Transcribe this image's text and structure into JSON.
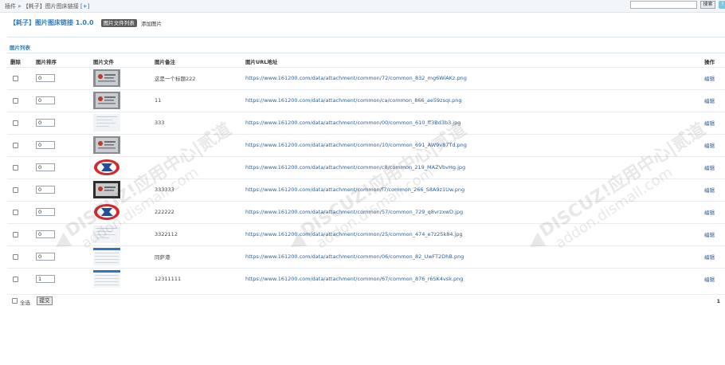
{
  "topbar": {
    "breadcrumb": "插件 » 【耗子】图片图床链接",
    "add_link": "[+]",
    "search_button": "搜索",
    "search_placeholder": ""
  },
  "header": {
    "plugin_title": "【耗子】图片图床链接 1.0.0",
    "tab_active": "图片文件列表",
    "tab_add": "添加图片"
  },
  "panel": {
    "title": "图片列表",
    "columns": [
      "删除",
      "图片排序",
      "图片文件",
      "图片备注",
      "图片URL地址",
      "操作"
    ]
  },
  "rows": [
    {
      "order": "0",
      "thumb": "certificate",
      "note": "这是一个标题222",
      "url": "https://www.161200.com/data/attachment/common/72/common_832_mg6WiAKz.png",
      "action": "编辑"
    },
    {
      "order": "0",
      "thumb": "certificate",
      "note": "11",
      "url": "https://www.161200.com/data/attachment/common/ca/common_866_ae59zsqI.png",
      "action": "编辑"
    },
    {
      "order": "0",
      "thumb": "document",
      "note": "333",
      "url": "https://www.161200.com/data/attachment/common/00/common_610_ff3Bd3b3.jpg",
      "action": "编辑"
    },
    {
      "order": "0",
      "thumb": "certificate",
      "note": "",
      "url": "https://www.161200.com/data/attachment/common/10/common_691_AW9v87Td.png",
      "action": "编辑"
    },
    {
      "order": "0",
      "thumb": "logo",
      "note": "",
      "url": "https://www.161200.com/data/attachment/common/c8/common_219_MAZVbvHg.jpg",
      "action": "编辑"
    },
    {
      "order": "0",
      "thumb": "certificate-dark",
      "note": "333333",
      "url": "https://www.161200.com/data/attachment/common/f7/common_266_S8A9z1Uw.png",
      "action": "编辑"
    },
    {
      "order": "0",
      "thumb": "logo",
      "note": "222222",
      "url": "https://www.161200.com/data/attachment/common/57/common_729_q8vrzxwD.jpg",
      "action": "编辑"
    },
    {
      "order": "0",
      "thumb": "document",
      "note": "3322112",
      "url": "https://www.161200.com/data/attachment/common/25/common_474_e7z25k84.jpg",
      "action": "编辑"
    },
    {
      "order": "0",
      "thumb": "screenshot",
      "note": "同萨港",
      "url": "https://www.161200.com/data/attachment/common/06/common_82_UwFT2DhB.png",
      "action": "编辑"
    },
    {
      "order": "1",
      "thumb": "screenshot",
      "note": "12311111",
      "url": "https://www.161200.com/data/attachment/common/67/common_876_r6SK4vsk.png",
      "action": "编辑"
    }
  ],
  "footer": {
    "select_all": "全选",
    "submit": "提交",
    "page": "1"
  },
  "watermark": {
    "line1": "DISCUZ!应用中心|贰道",
    "line2": "addon.dismall.com"
  },
  "colors": {
    "accent": "#2b7bbf",
    "link": "#2b5f99",
    "tab_active_bg": "#5c5c5c"
  }
}
